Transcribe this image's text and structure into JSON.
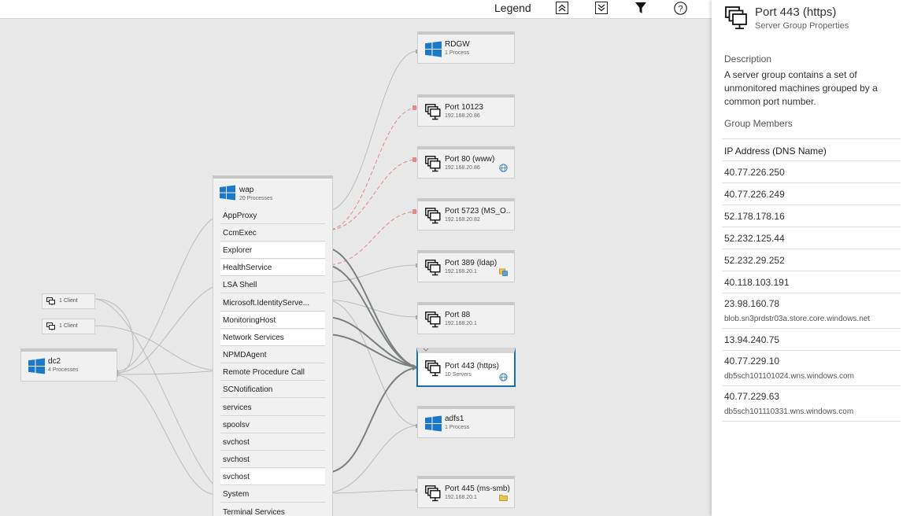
{
  "toolbar": {
    "legend_label": "Legend"
  },
  "nodes": {
    "rdgw": {
      "title": "RDGW",
      "subtitle": "1 Process"
    },
    "port10123": {
      "title": "Port 10123",
      "subtitle": "192.168.20.86"
    },
    "port80": {
      "title": "Port 80 (www)",
      "subtitle": "192.168.20.86"
    },
    "port5723": {
      "title": "Port 5723 (MS_O...",
      "subtitle": "192.168.20.82"
    },
    "port389": {
      "title": "Port 389 (ldap)",
      "subtitle": "192.168.20.1"
    },
    "port88": {
      "title": "Port 88",
      "subtitle": "192.168.20.1"
    },
    "port443": {
      "title": "Port 443 (https)",
      "subtitle": "10 Servers"
    },
    "adfs1": {
      "title": "adfs1",
      "subtitle": "1 Process"
    },
    "port445": {
      "title": "Port 445 (ms-smb)",
      "subtitle": "192.168.20.1"
    },
    "dc2": {
      "title": "dc2",
      "subtitle": "4 Processes"
    }
  },
  "clients": [
    {
      "label": "1 Client"
    },
    {
      "label": "1 Client"
    }
  ],
  "wap": {
    "title": "wap",
    "subtitle": "20 Processes",
    "processes": [
      "AppProxy",
      "CcmExec",
      "Explorer",
      "HealthService",
      "LSA Shell",
      "Microsoft.IdentityServe...",
      "MonitoringHost",
      "Network Services",
      "NPMDAgent",
      "Remote Procedure Call",
      "SCNotification",
      "services",
      "spoolsv",
      "svchost",
      "svchost",
      "svchost",
      "System",
      "Terminal Services"
    ]
  },
  "panel": {
    "title": "Port 443 (https)",
    "subtitle": "Server Group Properties",
    "description_heading": "Description",
    "description": "A server group contains a set of unmonitored machines grouped by a common port number.",
    "members_heading": "Group Members",
    "table_header": "IP Address (DNS Name)",
    "members": [
      {
        "ip": "40.77.226.250",
        "dns": ""
      },
      {
        "ip": "40.77.226.249",
        "dns": ""
      },
      {
        "ip": "52.178.178.16",
        "dns": ""
      },
      {
        "ip": "52.232.125.44",
        "dns": ""
      },
      {
        "ip": "52.232.29.252",
        "dns": ""
      },
      {
        "ip": "40.118.103.191",
        "dns": ""
      },
      {
        "ip": "23.98.160.78",
        "dns": "blob.sn3prdstr03a.store.core.windows.net"
      },
      {
        "ip": "13.94.240.75",
        "dns": ""
      },
      {
        "ip": "40.77.229.10",
        "dns": "db5sch101101024.wns.windows.com"
      },
      {
        "ip": "40.77.229.63",
        "dns": "db5sch101110331.wns.windows.com"
      }
    ]
  },
  "colors": {
    "selected_border": "#1a6fb0",
    "failed_edge": "#e08080",
    "windows_blue": "#1e78c8"
  }
}
